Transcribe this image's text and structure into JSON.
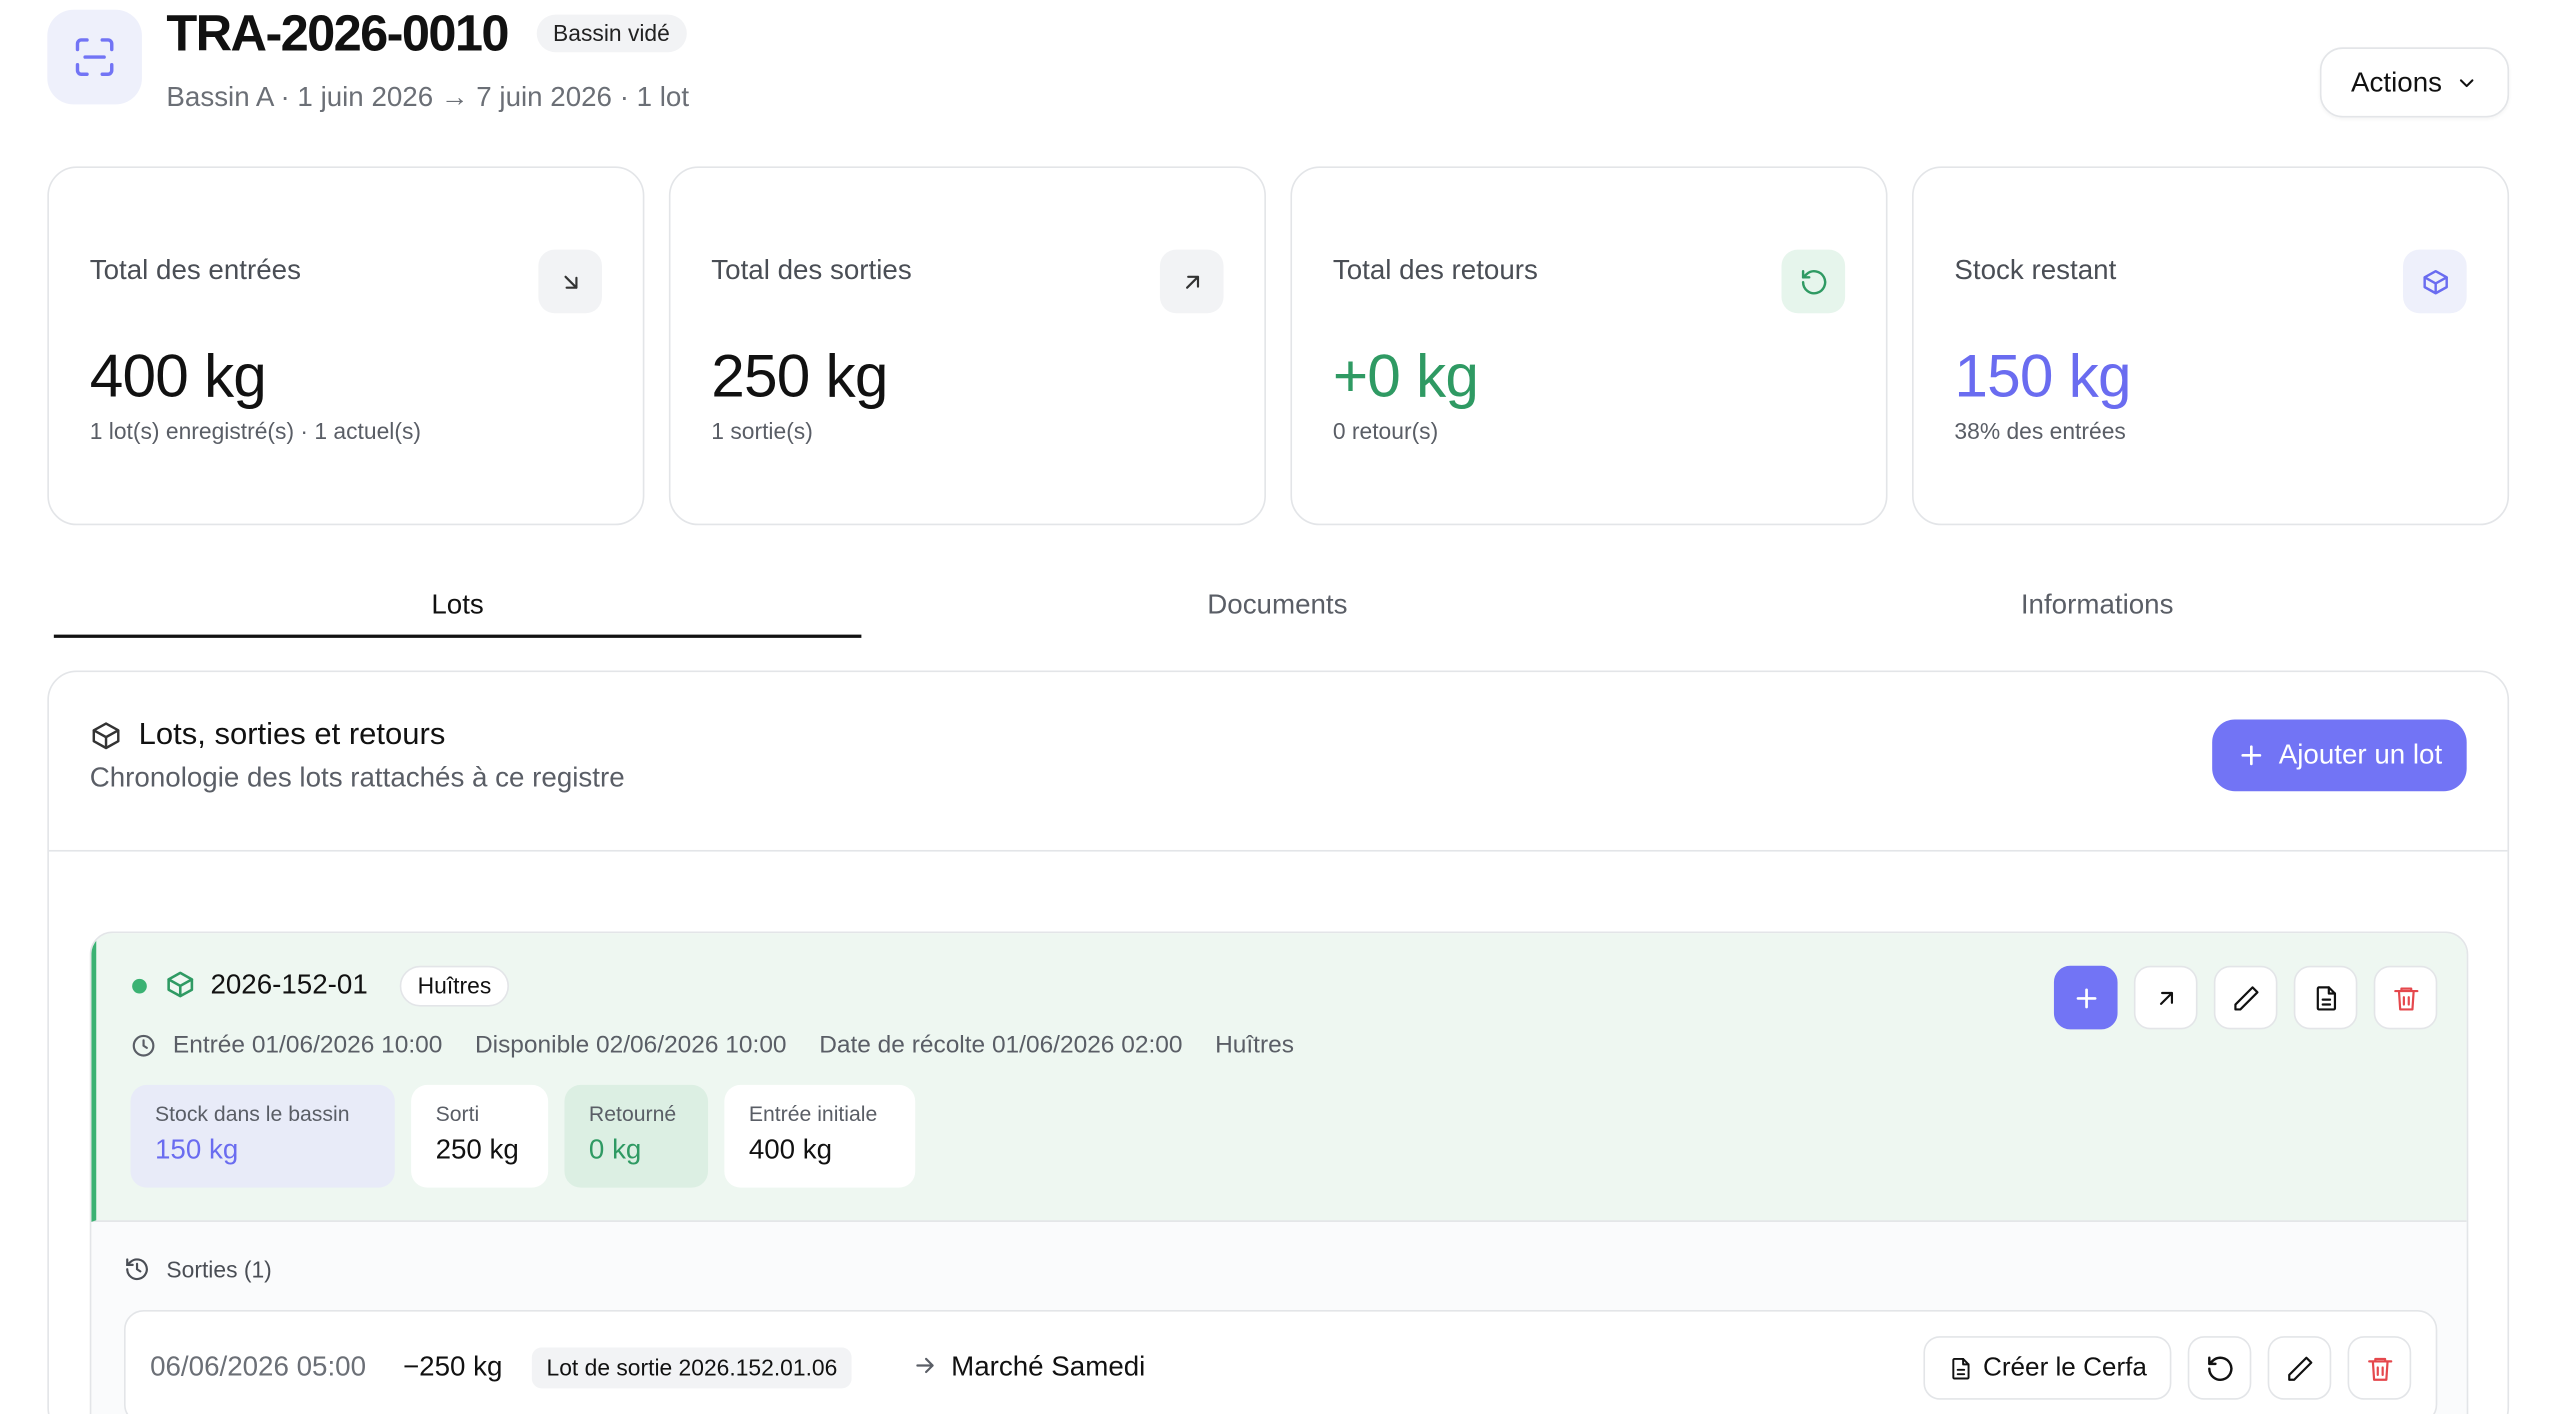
{
  "header": {
    "title": "TRA-2026-0010",
    "status_badge": "Bassin vidé",
    "subtitle": "Bassin A · 1 juin 2026 → 7 juin 2026 · 1 lot",
    "actions_label": "Actions",
    "icon": "scan-icon"
  },
  "cards": [
    {
      "label": "Total des entrées",
      "value": "400 kg",
      "note": "1 lot(s) enregistré(s) · 1 actuel(s)",
      "icon": "arrow-down-right-icon"
    },
    {
      "label": "Total des sorties",
      "value": "250 kg",
      "note": "1 sortie(s)",
      "icon": "arrow-up-right-icon"
    },
    {
      "label": "Total des retours",
      "value": "+0 kg",
      "note": "0 retour(s)",
      "icon": "rotate-ccw-icon",
      "color": "#2f9a63"
    },
    {
      "label": "Stock restant",
      "value": "150 kg",
      "note": "38% des entrées",
      "icon": "box-icon",
      "color": "#6a6cf0"
    }
  ],
  "tabs": [
    {
      "label": "Lots",
      "active": true
    },
    {
      "label": "Documents",
      "active": false
    },
    {
      "label": "Informations",
      "active": false
    }
  ],
  "panel": {
    "title": "Lots, sorties et retours",
    "subtitle": "Chronologie des lots rattachés à ce registre",
    "add_button": "Ajouter un lot"
  },
  "lot": {
    "code": "2026-152-01",
    "species": "Huîtres",
    "meta": {
      "entry": "Entrée 01/06/2026 10:00",
      "available": "Disponible 02/06/2026 10:00",
      "harvest": "Date de récolte 01/06/2026 02:00",
      "species": "Huîtres"
    },
    "stats": [
      {
        "label": "Stock dans le bassin",
        "value": "150 kg"
      },
      {
        "label": "Sorti",
        "value": "250 kg"
      },
      {
        "label": "Retourné",
        "value": "0 kg"
      },
      {
        "label": "Entrée initiale",
        "value": "400 kg"
      }
    ],
    "sorties_label": "Sorties (1)",
    "sortie": {
      "date": "06/06/2026 05:00",
      "qty": "−250 kg",
      "lot": "Lot de sortie 2026.152.01.06",
      "destination": "Marché Samedi",
      "cerfa_button": "Créer le Cerfa"
    }
  },
  "colors": {
    "accent": "#7274f5",
    "green": "#3bb273",
    "danger": "#e5484d"
  }
}
